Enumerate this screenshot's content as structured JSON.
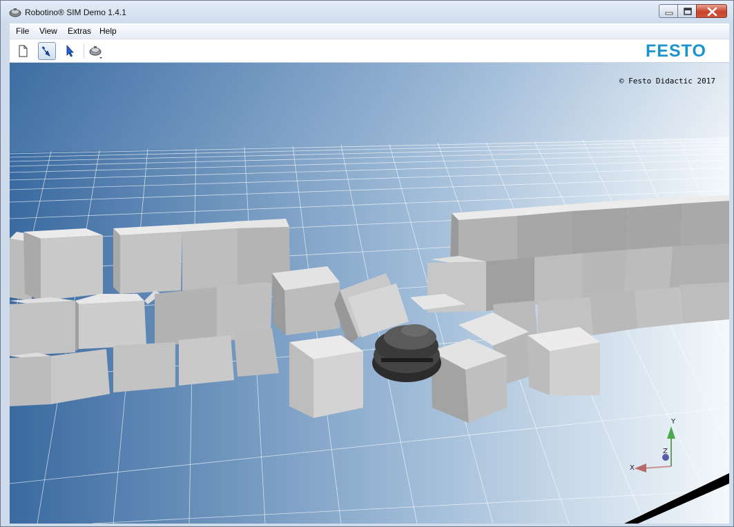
{
  "window": {
    "title": "Robotino® SIM Demo 1.4.1",
    "controls": {
      "minimize": "minimize",
      "maximize": "maximize",
      "close": "close"
    }
  },
  "menu": {
    "items": [
      {
        "label": "File"
      },
      {
        "label": "View"
      },
      {
        "label": "Extras"
      },
      {
        "label": "Help"
      }
    ]
  },
  "toolbar": {
    "buttons": [
      {
        "icon": "new-document-icon",
        "active": false
      },
      {
        "icon": "move-camera-icon",
        "active": true
      },
      {
        "icon": "select-pointer-icon",
        "active": false
      },
      {
        "icon": "robot-dropdown-icon",
        "active": false
      }
    ],
    "brand": "FESTO",
    "brand_color": "#1a93cf"
  },
  "viewport": {
    "copyright": "© Festo Didactic 2017",
    "axes": {
      "y": "Y",
      "z": "Z",
      "x": "X"
    }
  }
}
